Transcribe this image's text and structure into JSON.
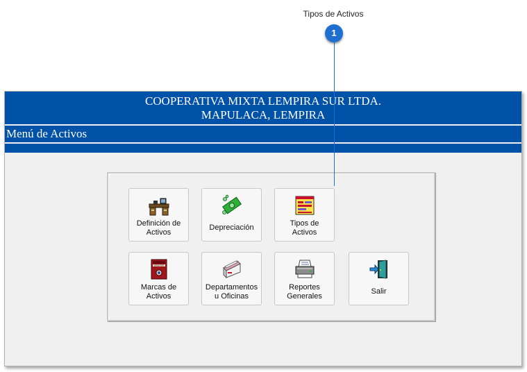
{
  "callout": {
    "title": "Tipos de Activos",
    "badge": "1"
  },
  "banner": {
    "line1": "COOPERATIVA MIXTA LEMPIRA SUR LTDA.",
    "line2": "MAPULACA, LEMPIRA"
  },
  "menu_title": "Menú de Activos",
  "buttons": {
    "definicion": {
      "label": "Definición de\nActivos",
      "icon": "desk-icon"
    },
    "depreciacion": {
      "label": "Depreciación",
      "icon": "money-icon"
    },
    "tipos": {
      "label": "Tipos de\nActivos",
      "icon": "form-window-icon"
    },
    "marcas": {
      "label": "Marcas de\nActivos",
      "icon": "dictionary-book-icon"
    },
    "departamentos": {
      "label": "Departamentos\nu Oficinas",
      "icon": "card-file-icon"
    },
    "reportes": {
      "label": "Reportes\nGenerales",
      "icon": "printer-icon"
    },
    "salir": {
      "label": "Salir",
      "icon": "exit-door-icon"
    }
  },
  "colors": {
    "banner_blue": "#0052a8",
    "callout_blue": "#1f6fd1",
    "window_bg": "#f0f0f0"
  }
}
